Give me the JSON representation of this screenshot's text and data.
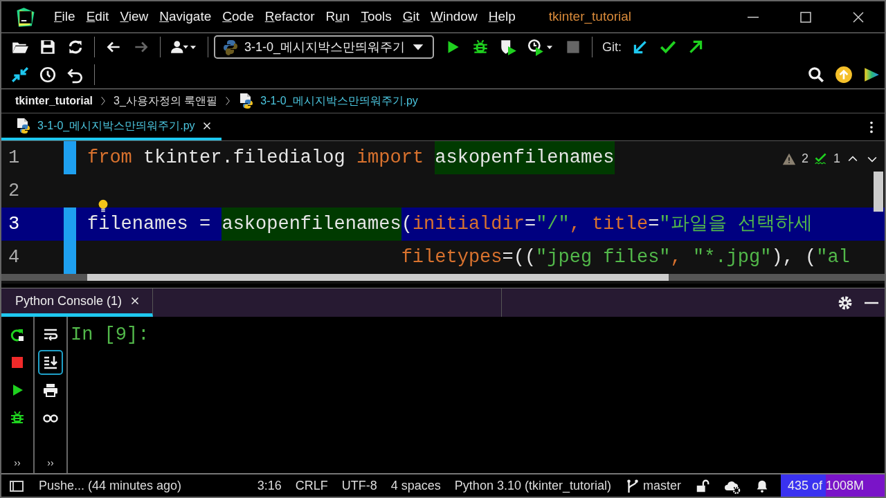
{
  "title_bar": {
    "menu": [
      {
        "key": "F",
        "after": "ile"
      },
      {
        "key": "E",
        "after": "dit"
      },
      {
        "key": "V",
        "after": "iew"
      },
      {
        "key": "N",
        "after": "avigate"
      },
      {
        "key": "C",
        "after": "ode"
      },
      {
        "key": "R",
        "after": "efactor"
      },
      {
        "before": "R",
        "key": "u",
        "after": "n"
      },
      {
        "key": "T",
        "after": "ools"
      },
      {
        "key": "G",
        "after": "it"
      },
      {
        "key": "W",
        "after": "indow"
      },
      {
        "key": "H",
        "after": "elp"
      }
    ],
    "project": "tkinter_tutorial"
  },
  "toolbar": {
    "row1": [
      {
        "kind": "open",
        "disabled": false
      },
      {
        "kind": "save",
        "disabled": false
      },
      {
        "kind": "sync",
        "disabled": false
      },
      {
        "kind": "separator",
        "disabled": false
      },
      {
        "kind": "back",
        "disabled": false
      },
      {
        "kind": "forward",
        "disabled": true
      },
      {
        "kind": "separator",
        "disabled": false
      },
      {
        "kind": "user",
        "disabled": false
      },
      {
        "kind": "separator",
        "disabled": false
      },
      {
        "kind": "config",
        "disabled": false,
        "label": "3-1-0_메시지박스만띄워주기"
      },
      {
        "kind": "run",
        "disabled": false
      },
      {
        "kind": "debug",
        "disabled": false
      },
      {
        "kind": "coverage",
        "disabled": false
      },
      {
        "kind": "profile",
        "disabled": false
      },
      {
        "kind": "stop",
        "disabled": true
      },
      {
        "kind": "separator",
        "disabled": false
      },
      {
        "kind": "label",
        "disabled": false,
        "label": "Git:"
      },
      {
        "kind": "update",
        "disabled": false
      },
      {
        "kind": "commit",
        "disabled": false
      },
      {
        "kind": "push",
        "disabled": false
      }
    ],
    "row2": [
      {
        "kind": "compare",
        "disabled": false
      },
      {
        "kind": "history",
        "disabled": false
      },
      {
        "kind": "revert",
        "disabled": false
      },
      {
        "kind": "separator",
        "disabled": false
      }
    ],
    "right": [
      {
        "kind": "search",
        "disabled": false
      },
      {
        "kind": "ideupdate",
        "disabled": false
      },
      {
        "kind": "toolbox",
        "disabled": false
      }
    ]
  },
  "breadcrumb": [
    {
      "label": "tkinter_tutorial",
      "kind": "project"
    },
    {
      "label": "3_사용자정의 룩앤필",
      "kind": "folder"
    },
    {
      "label": "3-1-0_메시지박스만띄워주기.py",
      "kind": "file"
    }
  ],
  "editor_tabs": [
    {
      "label": "3-1-0_메시지박스만띄워주기.py",
      "selected": true
    }
  ],
  "editor": {
    "warnings": "2",
    "typos": "1",
    "lines": [
      {
        "number": "1",
        "kind": "normal",
        "changed": true,
        "selected": false,
        "bulb": false,
        "tokens": [
          {
            "text": "from",
            "kind": "keyword"
          },
          {
            "text": " tkinter.filedialog ",
            "kind": "plain"
          },
          {
            "text": "import ",
            "kind": "keyword"
          },
          {
            "text": "askopenfilenames",
            "kind": "ref"
          }
        ]
      },
      {
        "number": "2",
        "kind": "normal",
        "changed": false,
        "selected": false,
        "bulb": true
      },
      {
        "number": "3",
        "kind": "normal",
        "changed": true,
        "selected": true,
        "bulb": false,
        "tokens": [
          {
            "text": "filenames = ",
            "kind": "plain"
          },
          {
            "text": "askopenfilenames",
            "kind": "ref"
          },
          {
            "text": "(",
            "kind": "plain"
          },
          {
            "text": "initialdir",
            "kind": "keyword"
          },
          {
            "text": "=",
            "kind": "plain"
          },
          {
            "text": "\"/\"",
            "kind": "string"
          },
          {
            "text": ", title",
            "kind": "keyword"
          },
          {
            "text": "=",
            "kind": "plain"
          },
          {
            "text": "\"파일을 선택하세",
            "kind": "string"
          }
        ]
      },
      {
        "number": "4",
        "kind": "continuation",
        "changed": true,
        "selected": false,
        "bulb": false,
        "tokens": [
          {
            "text": "filetypes",
            "kind": "keyword"
          },
          {
            "text": "=((",
            "kind": "plain"
          },
          {
            "text": "\"jpeg files\"",
            "kind": "string"
          },
          {
            "text": ", ",
            "kind": "keyword"
          },
          {
            "text": "\"*.jpg\"",
            "kind": "string"
          },
          {
            "text": "), (",
            "kind": "plain"
          },
          {
            "text": "\"al",
            "kind": "string"
          }
        ]
      }
    ]
  },
  "console": {
    "tab": {
      "label": "Python Console (1)",
      "selected": true
    },
    "left_tools": [
      {
        "kind": "rerun",
        "selected": false
      },
      {
        "kind": "stop",
        "selected": false
      },
      {
        "kind": "run",
        "selected": false
      },
      {
        "kind": "debug",
        "selected": false
      }
    ],
    "left_more": "››",
    "right_tools": [
      {
        "kind": "wrap",
        "selected": false
      },
      {
        "kind": "scrollend",
        "selected": true
      },
      {
        "kind": "print",
        "selected": false
      },
      {
        "kind": "glasses",
        "selected": false
      }
    ],
    "right_more": "››",
    "prompt": "In [9]:"
  },
  "status_bar": {
    "message": "Pushe... (44 minutes ago)",
    "items": [
      "3:16",
      "CRLF",
      "UTF-8",
      "4 spaces",
      "Python 3.10 (tkinter_tutorial)"
    ],
    "branch": "master",
    "memory": {
      "text": "435 of 1008M",
      "level": 0.43
    }
  }
}
